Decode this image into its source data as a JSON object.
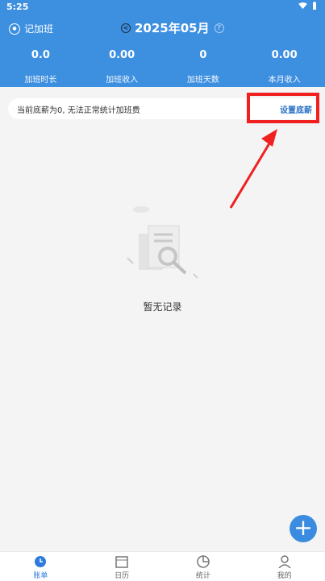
{
  "status_bar": {
    "time": "5:25"
  },
  "header": {
    "brand": "记加班",
    "month": "2025年05月",
    "arrow_icon": "<",
    "help_icon": "?"
  },
  "stats": [
    {
      "value": "0.0",
      "label": "加班时长"
    },
    {
      "value": "0.00",
      "label": "加班收入"
    },
    {
      "value": "0",
      "label": "加班天数"
    },
    {
      "value": "0.00",
      "label": "本月收入"
    }
  ],
  "notice": {
    "text": "当前底薪为0, 无法正常统计加班费",
    "link": "设置底薪"
  },
  "empty_state": {
    "text": "暂无记录"
  },
  "fab": {
    "symbol": "+"
  },
  "tabs": [
    {
      "label": "账单",
      "icon": "bill-icon"
    },
    {
      "label": "日历",
      "icon": "calendar-icon"
    },
    {
      "label": "统计",
      "icon": "chart-icon"
    },
    {
      "label": "我的",
      "icon": "user-icon"
    }
  ],
  "colors": {
    "primary": "#3d8fe0",
    "highlight": "#f02020"
  }
}
